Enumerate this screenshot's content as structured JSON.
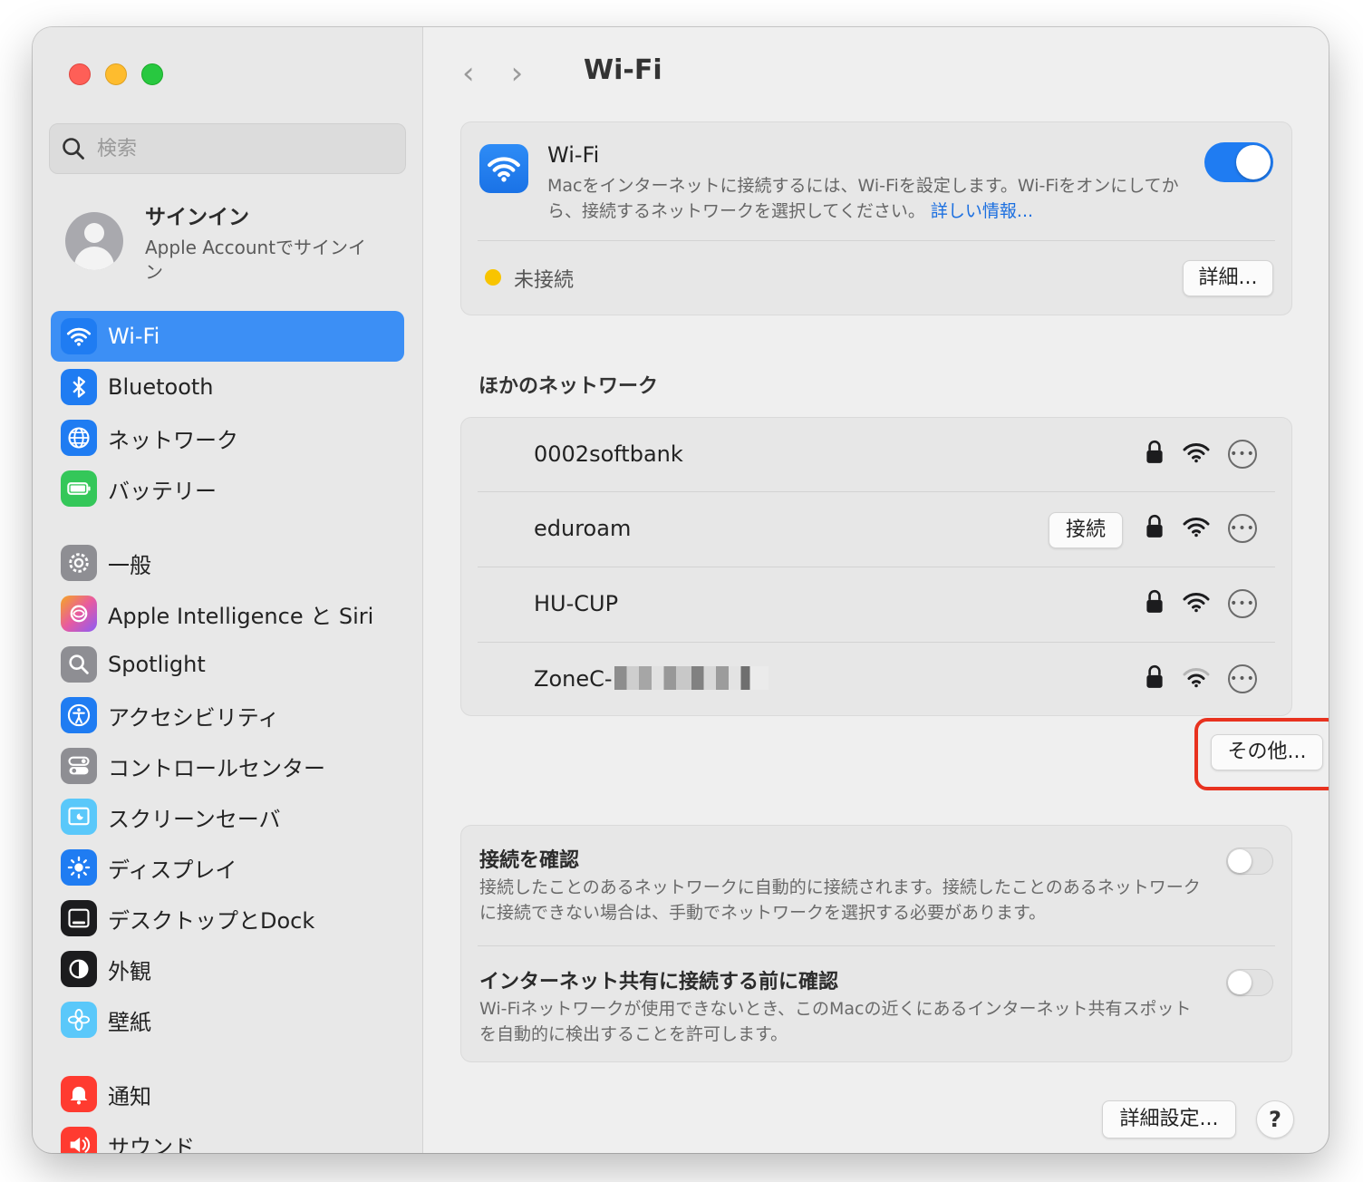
{
  "search": {
    "placeholder": "検索"
  },
  "account": {
    "name": "サインイン",
    "subtitle": "Apple Accountでサインイン"
  },
  "sidebar": {
    "items": [
      {
        "label": "Wi-Fi",
        "icon": "wifi-icon",
        "color": "#1f7cf2",
        "active": true
      },
      {
        "label": "Bluetooth",
        "icon": "bluetooth-icon",
        "color": "#1f7cf2"
      },
      {
        "label": "ネットワーク",
        "icon": "globe-icon",
        "color": "#1f7cf2"
      },
      {
        "label": "バッテリー",
        "icon": "battery-icon",
        "color": "#34c759"
      },
      {
        "label": "一般",
        "icon": "gear-icon",
        "color": "#8e8e93"
      },
      {
        "label": "Apple Intelligence と Siri",
        "icon": "siri-icon",
        "color": "#e85aa0"
      },
      {
        "label": "Spotlight",
        "icon": "magnifier-icon",
        "color": "#8e8e93"
      },
      {
        "label": "アクセシビリティ",
        "icon": "accessibility-icon",
        "color": "#1f7cf2"
      },
      {
        "label": "コントロールセンター",
        "icon": "control-center-icon",
        "color": "#8e8e93"
      },
      {
        "label": "スクリーンセーバ",
        "icon": "screensaver-icon",
        "color": "#5ac8fa"
      },
      {
        "label": "ディスプレイ",
        "icon": "sun-icon",
        "color": "#1f7cf2"
      },
      {
        "label": "デスクトップとDock",
        "icon": "dock-icon",
        "color": "#1c1c1e"
      },
      {
        "label": "外観",
        "icon": "appearance-icon",
        "color": "#1c1c1e"
      },
      {
        "label": "壁紙",
        "icon": "wallpaper-icon",
        "color": "#5ac8fa"
      },
      {
        "label": "通知",
        "icon": "bell-icon",
        "color": "#ff3b30"
      },
      {
        "label": "サウンド",
        "icon": "speaker-icon",
        "color": "#ff3b30"
      }
    ]
  },
  "header": {
    "title": "Wi-Fi",
    "back": "‹",
    "forward": "›"
  },
  "wifi": {
    "name": "Wi-Fi",
    "description": "Macをインターネットに接続するには、Wi-Fiを設定します。Wi-Fiをオンにしてから、接続するネットワークを選択してください。",
    "link": "詳しい情報...",
    "enabled": true,
    "status": "未接続",
    "status_color": "#f8c400",
    "details_button": "詳細..."
  },
  "other_networks": {
    "title": "ほかのネットワーク",
    "networks": [
      {
        "name": "0002softbank",
        "locked": true,
        "connect": ""
      },
      {
        "name": "eduroam",
        "locked": true,
        "connect": "接続"
      },
      {
        "name": "HU-CUP",
        "locked": true,
        "connect": ""
      },
      {
        "name": "ZoneC-",
        "locked": true,
        "connect": "",
        "redacted": true
      }
    ],
    "other_button": "その他..."
  },
  "ask": {
    "items": [
      {
        "title": "接続を確認",
        "description": "接続したことのあるネットワークに自動的に接続されます。接続したことのあるネットワークに接続できない場合は、手動でネットワークを選択する必要があります。",
        "enabled": false
      },
      {
        "title": "インターネット共有に接続する前に確認",
        "description": "Wi-Fiネットワークが使用できないとき、このMacの近くにあるインターネット共有スポットを自動的に検出することを許可します。",
        "enabled": false
      }
    ]
  },
  "footer": {
    "advanced_button": "詳細設定...",
    "help_button": "?"
  },
  "colors": {
    "accent": "#1f7cf2",
    "highlight": "#e8321f"
  }
}
